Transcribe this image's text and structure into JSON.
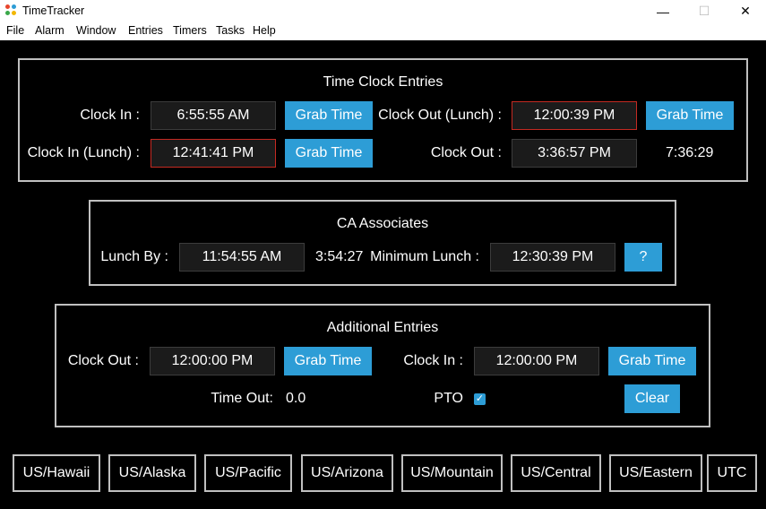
{
  "window": {
    "title": "TimeTracker",
    "minimize": "—",
    "maximize": "☐",
    "close": "✕"
  },
  "menu": [
    "File",
    "Alarm",
    "Window",
    "Entries",
    "Timers",
    "Tasks",
    "Help"
  ],
  "time_clock": {
    "title": "Time Clock Entries",
    "clock_in_label": "Clock In :",
    "clock_in_value": "6:55:55 AM",
    "clock_out_lunch_label": "Clock Out (Lunch) :",
    "clock_out_lunch_value": "12:00:39 PM",
    "clock_in_lunch_label": "Clock In (Lunch) :",
    "clock_in_lunch_value": "12:41:41 PM",
    "clock_out_label": "Clock Out :",
    "clock_out_value": "3:36:57 PM",
    "total": "7:36:29",
    "grab_time": "Grab Time"
  },
  "ca": {
    "title": "CA Associates",
    "lunch_by_label": "Lunch By :",
    "lunch_by_value": "11:54:55 AM",
    "remaining": "3:54:27",
    "min_lunch_label": "Minimum Lunch :",
    "min_lunch_value": "12:30:39 PM",
    "help_button": "?"
  },
  "additional": {
    "title": "Additional Entries",
    "clock_out_label": "Clock Out :",
    "clock_out_value": "12:00:00 PM",
    "clock_in_label": "Clock In :",
    "clock_in_value": "12:00:00 PM",
    "grab_time": "Grab Time",
    "time_out_label": "Time Out:",
    "time_out_value": "0.0",
    "pto_label": "PTO",
    "pto_checked": true,
    "clear": "Clear"
  },
  "timezones": [
    "US/Hawaii",
    "US/Alaska",
    "US/Pacific",
    "US/Arizona",
    "US/Mountain",
    "US/Central",
    "US/Eastern",
    "UTC"
  ],
  "colors": {
    "accent": "#2d9dd6",
    "error_border": "#c42a22",
    "frame": "#c0c0c0",
    "field_bg": "#1b1b1b"
  }
}
